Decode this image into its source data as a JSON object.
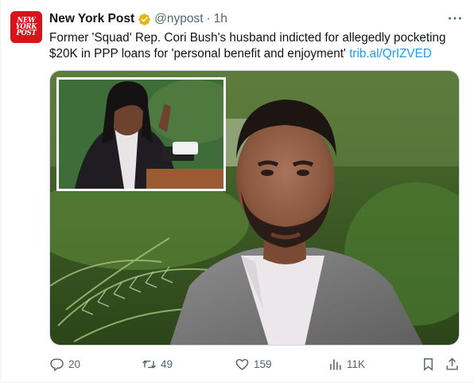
{
  "tweet": {
    "author_name": "New York Post",
    "handle": "@nypost",
    "separator": "·",
    "time": "1h",
    "avatar_text": [
      "NEW",
      "YORK",
      "POST"
    ],
    "text": "Former 'Squad' Rep. Cori Bush's husband indicted for allegedly pocketing $20K in PPP loans for 'personal benefit and enjoyment'",
    "link": "trib.al/QrIZVED",
    "verified_badge": "gold-check-badge"
  },
  "media": {
    "main_image": "man-in-gray-blazer-selfie-with-ferns",
    "inset_image": "woman-speaking-at-podium"
  },
  "actions": {
    "replies": "20",
    "reposts": "49",
    "likes": "159",
    "views": "11K"
  },
  "colors": {
    "brand_red": "#d8141a",
    "link_blue": "#1d9bf0",
    "muted": "#536471",
    "badge_gold": "#e2b719"
  }
}
